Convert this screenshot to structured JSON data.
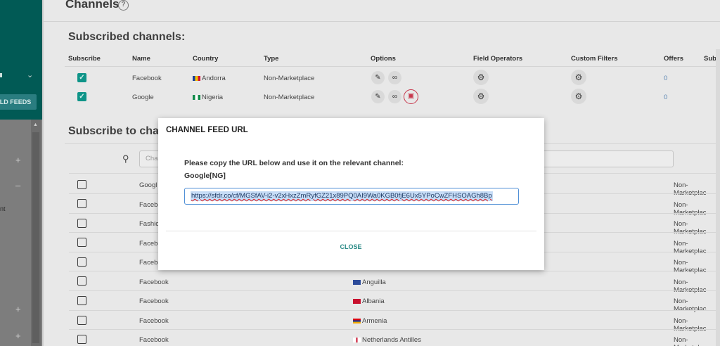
{
  "sidebar": {
    "build_feeds_label": "LD FEEDS",
    "partial_text": "nt",
    "chevron_icon": "chevron-down-icon"
  },
  "page": {
    "title": "Channels",
    "help_icon": "help-circle-icon"
  },
  "subscribed": {
    "title": "Subscribed channels:",
    "headers": [
      "Subscribe",
      "Name",
      "Country",
      "Type",
      "Options",
      "Field Operators",
      "Custom Filters",
      "Offers",
      "Subm"
    ],
    "rows": [
      {
        "name": "Facebook",
        "country": "Andorra",
        "type": "Non-Marketplace",
        "offers": "0",
        "flag_colors": [
          "#1a3f9c",
          "#f2c400",
          "#d0103a"
        ],
        "has_store_option": false
      },
      {
        "name": "Google",
        "country": "Nigeria",
        "type": "Non-Marketplace",
        "offers": "0",
        "flag_colors": [
          "#118a4a",
          "#ffffff",
          "#118a4a"
        ],
        "has_store_option": true
      }
    ]
  },
  "subscribe_to": {
    "title": "Subscribe to chan",
    "search_placeholder": "Cha",
    "rows": [
      {
        "name": "Googl",
        "country": "",
        "type": "Non-Marketplac"
      },
      {
        "name": "Faceb",
        "country": "",
        "type": "Non-Marketplac"
      },
      {
        "name": "Fashic",
        "country": "",
        "type": "Non-Marketplac"
      },
      {
        "name": "Faceb",
        "country": "",
        "type": "Non-Marketplac"
      },
      {
        "name": "Faceb",
        "country": "",
        "type": "Non-Marketplac"
      },
      {
        "name": "Facebook",
        "country": "Anguilla",
        "type": "Non-Marketplac"
      },
      {
        "name": "Facebook",
        "country": "Albania",
        "type": "Non-Marketplac"
      },
      {
        "name": "Facebook",
        "country": "Armenia",
        "type": "Non-Marketplac"
      },
      {
        "name": "Facebook",
        "country": "Netherlands Antilles",
        "type": "Non-Marketplac"
      }
    ]
  },
  "modal": {
    "title": "CHANNEL FEED URL",
    "instruction": "Please copy the URL below and use it on the relevant channel:",
    "channel": "Google[NG]",
    "url": "https://sfdr.co/cf/MGSfAV-i2-v2xHxzZmRyfGZ21x89PQ0AI9Wa0KGB0fjE6Ux5YPoCwZFHSOAGh8Bp",
    "close_label": "CLOSE"
  },
  "colors": {
    "teal": "#015a55",
    "accent": "#0e9488",
    "danger": "#c7374c",
    "link": "#5b86b3"
  }
}
